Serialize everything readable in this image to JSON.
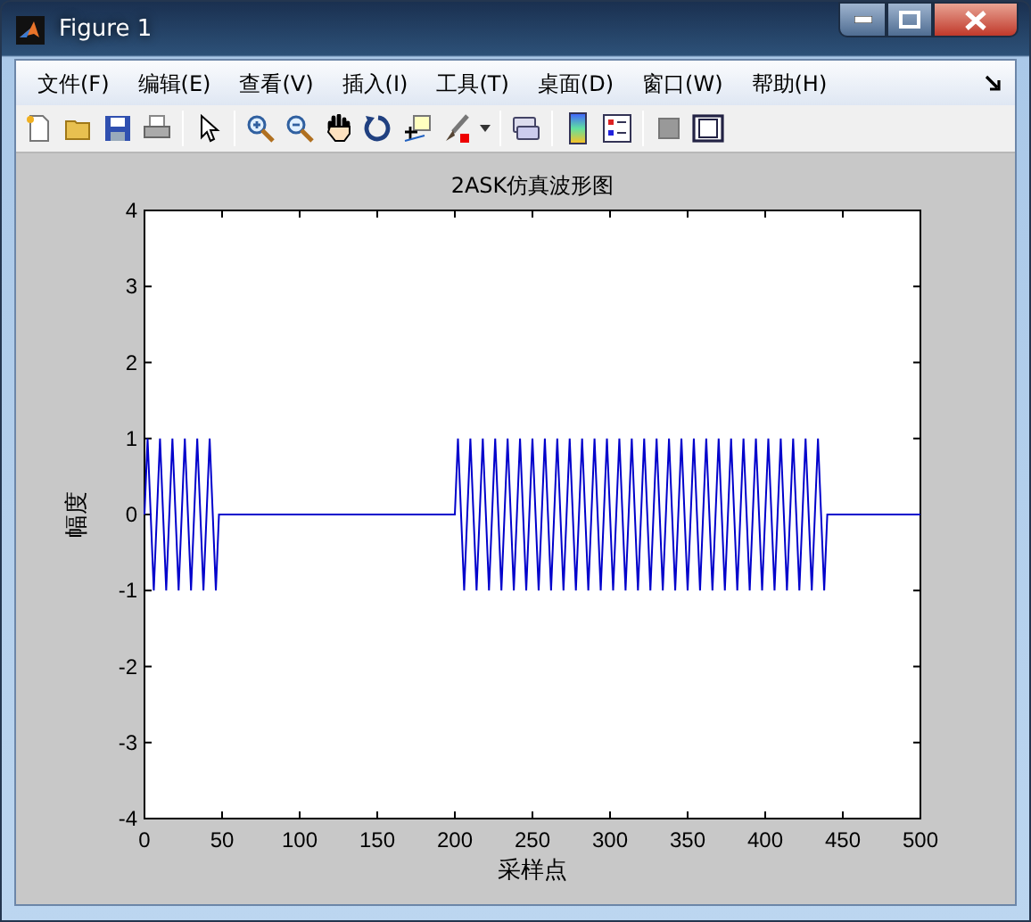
{
  "window": {
    "title": "Figure 1"
  },
  "menu": [
    "文件(F)",
    "编辑(E)",
    "查看(V)",
    "插入(I)",
    "工具(T)",
    "桌面(D)",
    "窗口(W)",
    "帮助(H)"
  ],
  "figure": {
    "chart_data": {
      "type": "line",
      "title": "2ASK仿真波形图",
      "xlabel": "采样点",
      "ylabel": "幅度",
      "x": [
        0,
        2,
        4,
        6,
        8,
        10,
        12,
        14,
        16,
        18,
        20,
        22,
        24,
        26,
        28,
        30,
        32,
        34,
        36,
        38,
        40,
        42,
        44,
        46,
        48,
        50,
        52,
        54,
        56,
        58,
        60,
        62,
        64,
        66,
        68,
        70,
        72,
        74,
        76,
        78,
        80,
        82,
        84,
        86,
        88,
        90,
        92,
        94,
        96,
        98,
        100,
        102,
        104,
        106,
        108,
        110,
        112,
        114,
        116,
        118,
        120,
        122,
        124,
        126,
        128,
        130,
        132,
        134,
        136,
        138,
        140,
        142,
        144,
        146,
        148,
        150,
        152,
        154,
        156,
        158,
        160,
        162,
        164,
        166,
        168,
        170,
        172,
        174,
        176,
        178,
        180,
        182,
        184,
        186,
        188,
        190,
        192,
        194,
        196,
        198,
        200,
        202,
        204,
        206,
        208,
        210,
        212,
        214,
        216,
        218,
        220,
        222,
        224,
        226,
        228,
        230,
        232,
        234,
        236,
        238,
        240,
        242,
        244,
        246,
        248,
        250,
        252,
        254,
        256,
        258,
        260,
        262,
        264,
        266,
        268,
        270,
        272,
        274,
        276,
        278,
        280,
        282,
        284,
        286,
        288,
        290,
        292,
        294,
        296,
        298,
        300,
        302,
        304,
        306,
        308,
        310,
        312,
        314,
        316,
        318,
        320,
        322,
        324,
        326,
        328,
        330,
        332,
        334,
        336,
        338,
        340,
        342,
        344,
        346,
        348,
        350,
        352,
        354,
        356,
        358,
        360,
        362,
        364,
        366,
        368,
        370,
        372,
        374,
        376,
        378,
        380,
        382,
        384,
        386,
        388,
        390,
        392,
        394,
        396,
        398,
        400,
        402,
        404,
        406,
        408,
        410,
        412,
        414,
        416,
        418,
        420,
        422,
        424,
        426,
        428,
        430,
        432,
        434,
        436,
        438,
        440,
        442,
        444,
        446,
        448,
        450,
        452,
        454,
        456,
        458,
        460,
        462,
        464,
        466,
        468,
        470,
        472,
        474,
        476,
        478,
        480,
        482,
        484,
        486,
        488,
        490,
        492,
        494,
        496,
        498,
        500
      ],
      "series": [
        {
          "color": "#0000cc",
          "values": [
            0,
            1,
            0,
            -1,
            0,
            1,
            0,
            -1,
            0,
            1,
            0,
            -1,
            0,
            1,
            0,
            -1,
            0,
            1,
            0,
            -1,
            0,
            1,
            0,
            -1,
            0,
            0,
            0,
            0,
            0,
            0,
            0,
            0,
            0,
            0,
            0,
            0,
            0,
            0,
            0,
            0,
            0,
            0,
            0,
            0,
            0,
            0,
            0,
            0,
            0,
            0,
            0,
            0,
            0,
            0,
            0,
            0,
            0,
            0,
            0,
            0,
            0,
            0,
            0,
            0,
            0,
            0,
            0,
            0,
            0,
            0,
            0,
            0,
            0,
            0,
            0,
            0,
            0,
            0,
            0,
            0,
            0,
            0,
            0,
            0,
            0,
            0,
            0,
            0,
            0,
            0,
            0,
            0,
            0,
            0,
            0,
            0,
            0,
            0,
            0,
            0,
            0,
            1,
            0,
            -1,
            0,
            1,
            0,
            -1,
            0,
            1,
            0,
            -1,
            0,
            1,
            0,
            -1,
            0,
            1,
            0,
            -1,
            0,
            1,
            0,
            -1,
            0,
            1,
            0,
            -1,
            0,
            1,
            0,
            -1,
            0,
            1,
            0,
            -1,
            0,
            1,
            0,
            -1,
            0,
            1,
            0,
            -1,
            0,
            1,
            0,
            -1,
            0,
            1,
            0,
            -1,
            0,
            1,
            0,
            -1,
            0,
            1,
            0,
            -1,
            0,
            1,
            0,
            -1,
            0,
            1,
            0,
            -1,
            0,
            1,
            0,
            -1,
            0,
            1,
            0,
            -1,
            0,
            1,
            0,
            -1,
            0,
            1,
            0,
            -1,
            0,
            1,
            0,
            -1,
            0,
            1,
            0,
            -1,
            0,
            1,
            0,
            -1,
            0,
            1,
            0,
            -1,
            0,
            1,
            0,
            -1,
            0,
            1,
            0,
            -1,
            0,
            1,
            0,
            -1,
            0,
            1,
            0,
            -1,
            0,
            1,
            0,
            -1,
            0,
            0,
            0,
            0,
            0,
            0,
            0,
            0,
            0,
            0,
            0,
            0,
            0,
            0,
            0,
            0,
            0,
            0,
            0,
            0,
            0,
            0,
            0,
            0,
            0,
            0,
            0,
            0,
            0,
            0,
            0
          ]
        }
      ],
      "xlim": [
        0,
        500
      ],
      "ylim": [
        -4,
        4
      ],
      "xticks": [
        0,
        50,
        100,
        150,
        200,
        250,
        300,
        350,
        400,
        450,
        500
      ],
      "yticks": [
        -4,
        -3,
        -2,
        -1,
        0,
        1,
        2,
        3,
        4
      ]
    }
  }
}
